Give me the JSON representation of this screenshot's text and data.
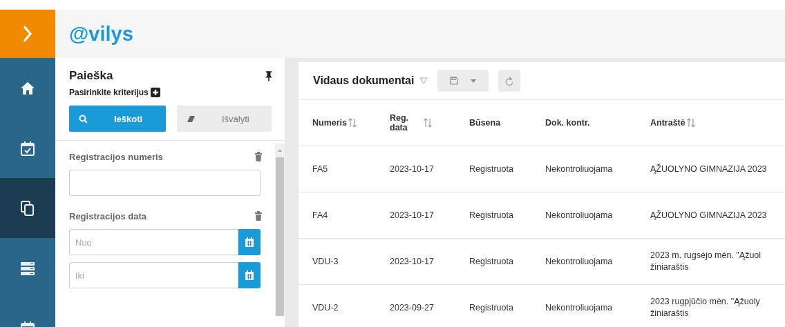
{
  "logo": "@vilys",
  "nav": [
    {
      "kind": "home",
      "selected": false
    },
    {
      "kind": "calendar",
      "selected": false
    },
    {
      "kind": "documents",
      "selected": true
    },
    {
      "kind": "server",
      "selected": false
    },
    {
      "kind": "calendar",
      "selected": false
    }
  ],
  "search_panel": {
    "title": "Paieška",
    "subtitle": "Pasirinkite kriterijus",
    "buttons": [
      {
        "label": "Ieškoti",
        "kind": "primary"
      },
      {
        "label": "Išvalyti",
        "kind": "secondary"
      }
    ],
    "fields": [
      {
        "label": "Registracijos numeris",
        "kind": "text"
      },
      {
        "label": "Registracijos data",
        "kind": "date_range",
        "inputs": [
          {
            "placeholder": "Nuo"
          },
          {
            "placeholder": "Iki"
          }
        ]
      }
    ]
  },
  "main": {
    "title": "Vidaus dokumentai",
    "table": {
      "columns": [
        {
          "label": "Numeris",
          "sortable": true
        },
        {
          "label": "Reg.\ndata",
          "sortable": true
        },
        {
          "label": "Būsena",
          "sortable": false
        },
        {
          "label": "Dok. kontr.",
          "sortable": false
        },
        {
          "label": "Antraštė",
          "sortable": true
        }
      ],
      "rows": [
        [
          "FA5",
          "2023-10-17",
          "Registruota",
          "Nekontroliuojama",
          "ĄŽUOLYNO GIMNAZIJA 2023"
        ],
        [
          "FA4",
          "2023-10-17",
          "Registruota",
          "Nekontroliuojama",
          "ĄŽUOLYNO GIMNAZIJA 2023"
        ],
        [
          "VDU-3",
          "2023-10-17",
          "Registruota",
          "Nekontroliuojama",
          "2023 m. rugsėjo mėn. \"Ąžuol\nžiniaraštis"
        ],
        [
          "VDU-2",
          "2023-09-27",
          "Registruota",
          "Nekontroliuojama",
          "2023 rugpjūčio mėn. \"Ąžuoly\nžiniaraštis"
        ]
      ]
    }
  }
}
